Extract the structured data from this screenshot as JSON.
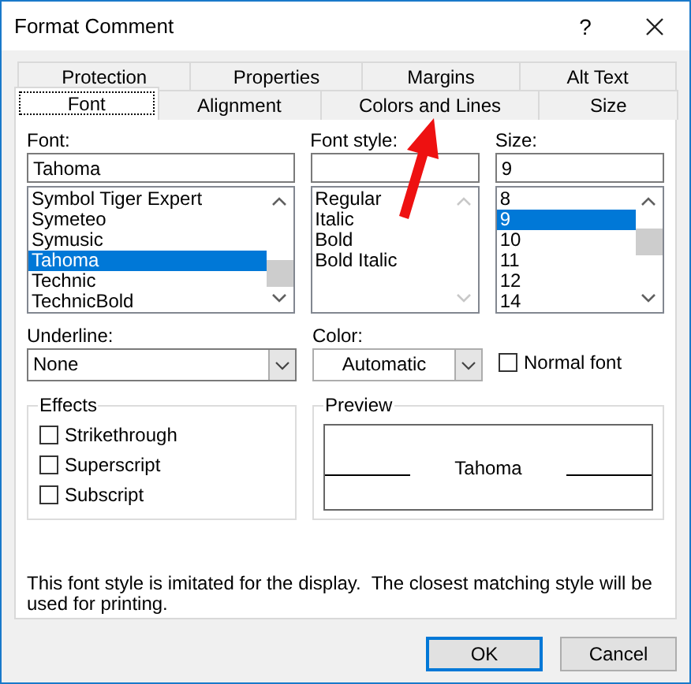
{
  "window": {
    "title": "Format Comment",
    "help": "?"
  },
  "tabs": [
    [
      {
        "label": "Protection",
        "selected": false
      },
      {
        "label": "Properties",
        "selected": false
      },
      {
        "label": "Margins",
        "selected": false
      },
      {
        "label": "Alt Text",
        "selected": false
      }
    ],
    [
      {
        "label": "Font",
        "selected": true
      },
      {
        "label": "Alignment",
        "selected": false
      },
      {
        "label": "Colors and Lines",
        "selected": false
      },
      {
        "label": "Size",
        "selected": false
      }
    ]
  ],
  "font": {
    "label": "Font:",
    "value": "Tahoma",
    "items": [
      {
        "label": "Symbol Tiger Expert",
        "selected": false
      },
      {
        "label": "Symeteo",
        "selected": false
      },
      {
        "label": "Symusic",
        "selected": false
      },
      {
        "label": "Tahoma",
        "selected": true
      },
      {
        "label": "Technic",
        "selected": false
      },
      {
        "label": "TechnicBold",
        "selected": false
      }
    ]
  },
  "font_style": {
    "label": "Font style:",
    "items": [
      {
        "label": "Regular",
        "selected": false
      },
      {
        "label": "Italic",
        "selected": false
      },
      {
        "label": "Bold",
        "selected": false
      },
      {
        "label": "Bold Italic",
        "selected": false
      }
    ]
  },
  "size": {
    "label": "Size:",
    "value": "9",
    "items": [
      {
        "label": "8",
        "selected": false
      },
      {
        "label": "9",
        "selected": true
      },
      {
        "label": "10",
        "selected": false
      },
      {
        "label": "11",
        "selected": false
      },
      {
        "label": "12",
        "selected": false
      },
      {
        "label": "14",
        "selected": false
      }
    ]
  },
  "underline": {
    "label": "Underline:",
    "value": "None"
  },
  "color": {
    "label": "Color:",
    "value": "Automatic"
  },
  "normal_font": {
    "label": "Normal font",
    "checked": false
  },
  "effects": {
    "title": "Effects",
    "options": [
      {
        "label": "Strikethrough",
        "checked": false
      },
      {
        "label": "Superscript",
        "checked": false
      },
      {
        "label": "Subscript",
        "checked": false
      }
    ]
  },
  "preview": {
    "title": "Preview",
    "sample": "Tahoma"
  },
  "note": "This font style is imitated for the display.  The closest matching style will be used for printing.",
  "buttons": [
    {
      "label": "OK",
      "default": true
    },
    {
      "label": "Cancel",
      "default": false
    }
  ]
}
